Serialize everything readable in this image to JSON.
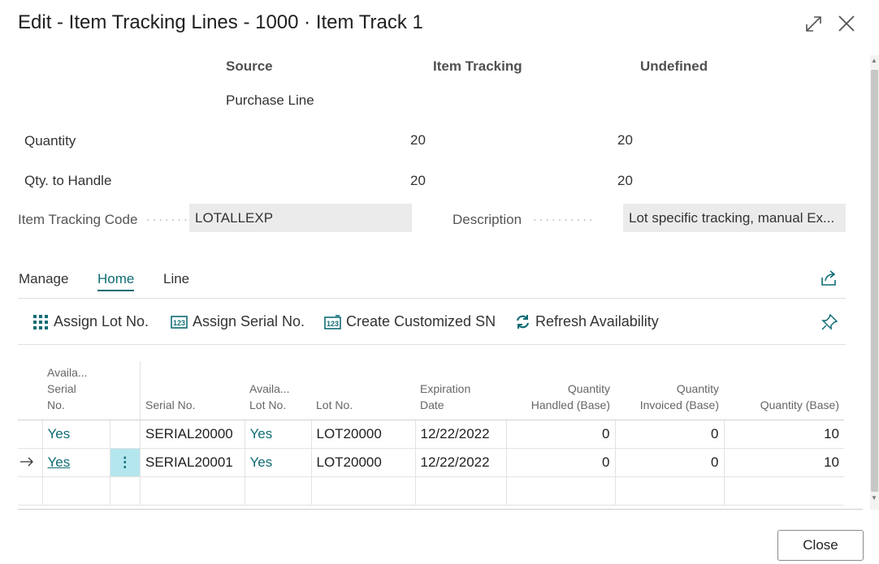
{
  "dialog": {
    "title": "Edit - Item Tracking Lines - 1000 · Item Track 1"
  },
  "summary": {
    "headers": {
      "source": "Source",
      "item_tracking": "Item Tracking",
      "undefined": "Undefined"
    },
    "source_value": "Purchase Line",
    "quantity": {
      "label": "Quantity",
      "item_tracking": "20",
      "undefined": "20"
    },
    "qty_to_handle": {
      "label": "Qty. to Handle",
      "item_tracking": "20",
      "undefined": "20"
    }
  },
  "fields": {
    "item_tracking_code": {
      "label": "Item Tracking Code",
      "value": "LOTALLEXP"
    },
    "description": {
      "label": "Description",
      "value": "Lot specific tracking, manual Ex..."
    }
  },
  "tabs": [
    "Manage",
    "Home",
    "Line"
  ],
  "active_tab": "Home",
  "actions": {
    "assign_lot": "Assign Lot No.",
    "assign_serial": "Assign Serial No.",
    "create_sn": "Create Customized SN",
    "refresh": "Refresh Availability"
  },
  "table": {
    "columns": {
      "avail_serial": [
        "Availa...",
        "Serial",
        "No."
      ],
      "serial_no": "Serial No.",
      "avail_lot": [
        "Availa...",
        "Lot No."
      ],
      "lot_no": "Lot No.",
      "expiration": [
        "Expiration",
        "Date"
      ],
      "qty_handled": [
        "Quantity",
        "Handled (Base)"
      ],
      "qty_invoiced": [
        "Quantity",
        "Invoiced (Base)"
      ],
      "qty_base": "Quantity (Base)"
    },
    "rows": [
      {
        "avail_serial": "Yes",
        "serial_no": "SERIAL20000",
        "avail_lot": "Yes",
        "lot_no": "LOT20000",
        "expiration": "12/22/2022",
        "qty_handled": "0",
        "qty_invoiced": "0",
        "qty_base": "10"
      },
      {
        "avail_serial": "Yes",
        "serial_no": "SERIAL20001",
        "avail_lot": "Yes",
        "lot_no": "LOT20000",
        "expiration": "12/22/2022",
        "qty_handled": "0",
        "qty_invoiced": "0",
        "qty_base": "10"
      }
    ]
  },
  "footer": {
    "close": "Close"
  },
  "colors": {
    "accent": "#0f6c74",
    "selected_cell": "#b4e6ee"
  }
}
